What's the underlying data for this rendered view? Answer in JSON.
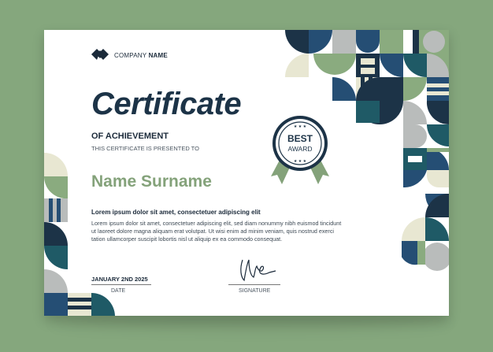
{
  "company": {
    "prefix": "COMPANY",
    "name": "NAME"
  },
  "title": "Certificate",
  "subtitle": "OF ACHIEVEMENT",
  "presented": "THIS CERTIFICATE IS PRESENTED TO",
  "recipient": "Name Surname",
  "lead": "Lorem ipsum dolor sit amet, consectetuer adipiscing elit",
  "body": "Lorem ipsum dolor sit amet, consectetuer adipiscing elit, sed diam nonummy nibh euismod tincidunt ut laoreet dolore magna aliquam erat volutpat. Ut wisi enim ad minim veniam, quis nostrud exerci tation ullamcorper suscipit lobortis nisl ut aliquip ex ea commodo consequat.",
  "badge": {
    "line1": "BEST",
    "line2": "AWARD"
  },
  "date_value": "JANUARY 2ND 2025",
  "date_label": "DATE",
  "signature_label": "SIGNATURE",
  "colors": {
    "background": "#85a77d",
    "navy": "#1c3347",
    "blue": "#254e74",
    "teal": "#1f5a66",
    "sage": "#8aab7f",
    "gray": "#b9bcbb",
    "cream": "#e8e7d2",
    "accent_name": "#84a27a"
  },
  "icons": [
    "company-logo-icon",
    "award-ribbon-icon",
    "signature-scribble"
  ]
}
